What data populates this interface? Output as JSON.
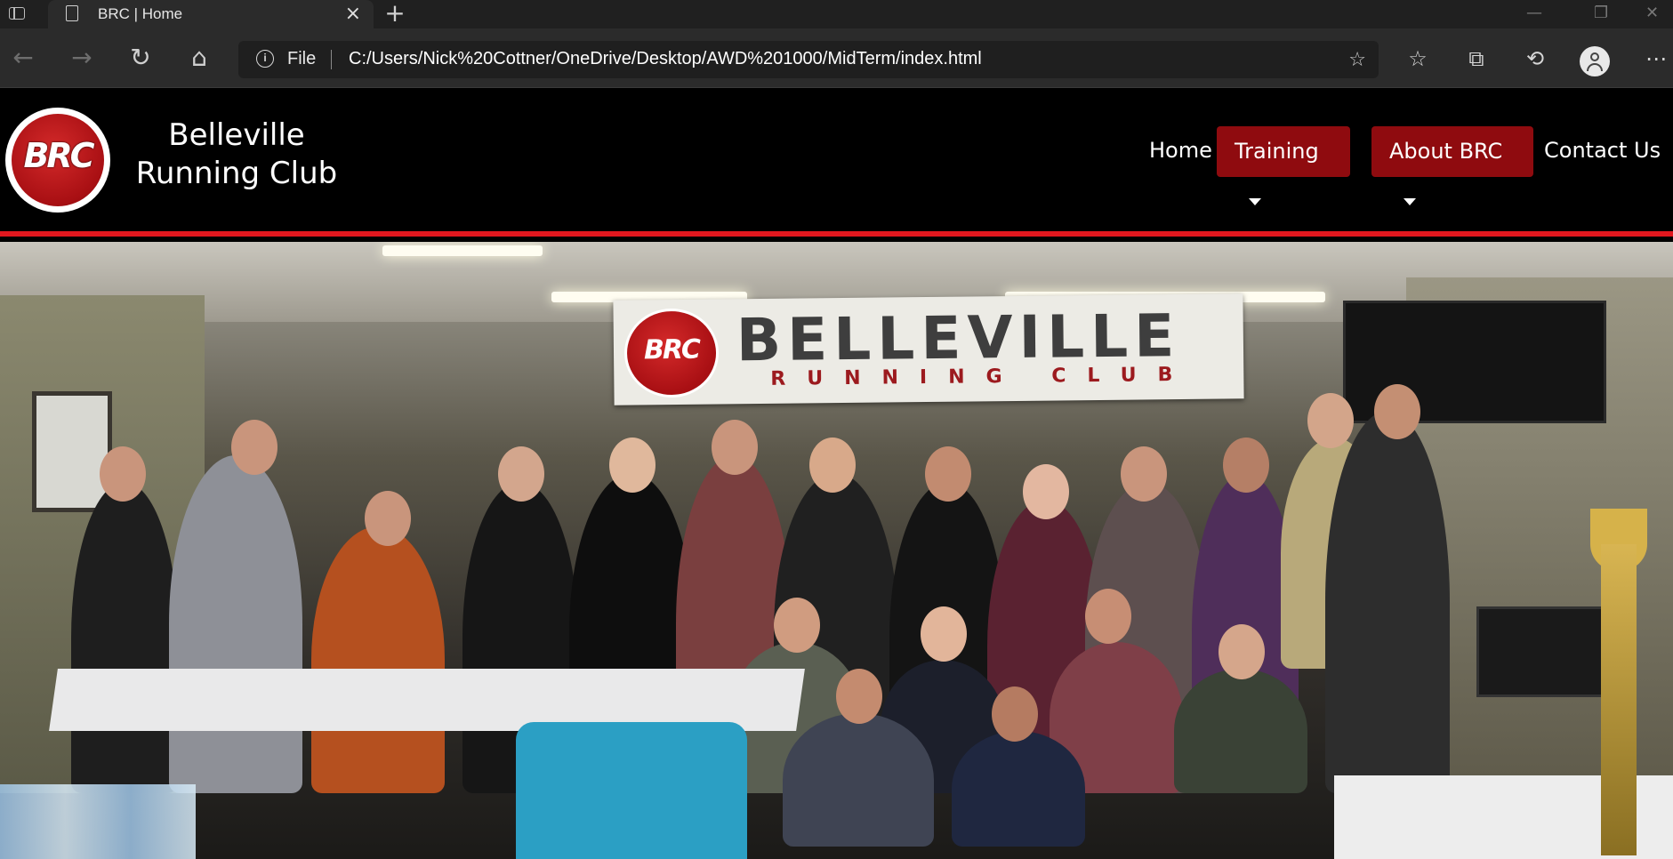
{
  "browser": {
    "tab_title": "BRC | Home",
    "address_scheme": "File",
    "address_url": "C:/Users/Nick%20Cottner/OneDrive/Desktop/AWD%201000/MidTerm/index.html"
  },
  "header": {
    "logo_text": "BRC",
    "site_name_line1": "Belleville",
    "site_name_line2": "Running Club"
  },
  "nav": {
    "home": "Home",
    "training": "Training",
    "about": "About BRC",
    "contact": "Contact Us"
  },
  "hero": {
    "banner_logo": "BRC",
    "banner_title": "BELLEVILLE",
    "banner_subtitle": "RUNNING CLUB"
  },
  "colors": {
    "accent_red": "#e1171e",
    "nav_button": "#8f0b0f",
    "header_bg": "#000000"
  }
}
